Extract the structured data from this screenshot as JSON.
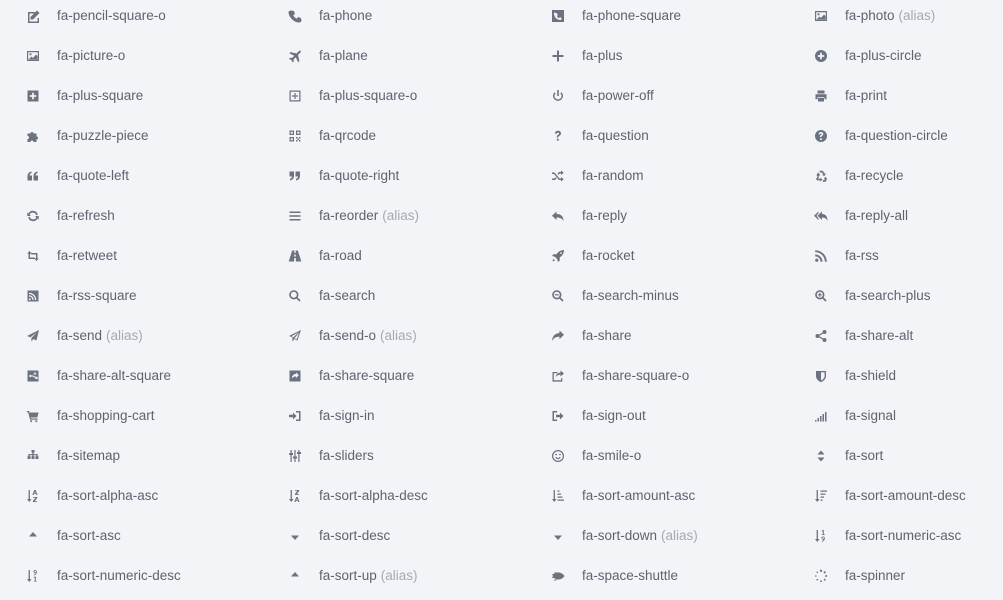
{
  "icons": [
    {
      "name": "fa-pencil-square-o",
      "icon": "pencil-square-o-icon",
      "alias": ""
    },
    {
      "name": "fa-phone",
      "icon": "phone-icon",
      "alias": ""
    },
    {
      "name": "fa-phone-square",
      "icon": "phone-square-icon",
      "alias": ""
    },
    {
      "name": "fa-photo",
      "icon": "photo-icon",
      "alias": "(alias)"
    },
    {
      "name": "fa-picture-o",
      "icon": "picture-o-icon",
      "alias": ""
    },
    {
      "name": "fa-plane",
      "icon": "plane-icon",
      "alias": ""
    },
    {
      "name": "fa-plus",
      "icon": "plus-icon",
      "alias": ""
    },
    {
      "name": "fa-plus-circle",
      "icon": "plus-circle-icon",
      "alias": ""
    },
    {
      "name": "fa-plus-square",
      "icon": "plus-square-icon",
      "alias": ""
    },
    {
      "name": "fa-plus-square-o",
      "icon": "plus-square-o-icon",
      "alias": ""
    },
    {
      "name": "fa-power-off",
      "icon": "power-off-icon",
      "alias": ""
    },
    {
      "name": "fa-print",
      "icon": "print-icon",
      "alias": ""
    },
    {
      "name": "fa-puzzle-piece",
      "icon": "puzzle-piece-icon",
      "alias": ""
    },
    {
      "name": "fa-qrcode",
      "icon": "qrcode-icon",
      "alias": ""
    },
    {
      "name": "fa-question",
      "icon": "question-icon",
      "alias": ""
    },
    {
      "name": "fa-question-circle",
      "icon": "question-circle-icon",
      "alias": ""
    },
    {
      "name": "fa-quote-left",
      "icon": "quote-left-icon",
      "alias": ""
    },
    {
      "name": "fa-quote-right",
      "icon": "quote-right-icon",
      "alias": ""
    },
    {
      "name": "fa-random",
      "icon": "random-icon",
      "alias": ""
    },
    {
      "name": "fa-recycle",
      "icon": "recycle-icon",
      "alias": ""
    },
    {
      "name": "fa-refresh",
      "icon": "refresh-icon",
      "alias": ""
    },
    {
      "name": "fa-reorder",
      "icon": "reorder-icon",
      "alias": "(alias)"
    },
    {
      "name": "fa-reply",
      "icon": "reply-icon",
      "alias": ""
    },
    {
      "name": "fa-reply-all",
      "icon": "reply-all-icon",
      "alias": ""
    },
    {
      "name": "fa-retweet",
      "icon": "retweet-icon",
      "alias": ""
    },
    {
      "name": "fa-road",
      "icon": "road-icon",
      "alias": ""
    },
    {
      "name": "fa-rocket",
      "icon": "rocket-icon",
      "alias": ""
    },
    {
      "name": "fa-rss",
      "icon": "rss-icon",
      "alias": ""
    },
    {
      "name": "fa-rss-square",
      "icon": "rss-square-icon",
      "alias": ""
    },
    {
      "name": "fa-search",
      "icon": "search-icon",
      "alias": ""
    },
    {
      "name": "fa-search-minus",
      "icon": "search-minus-icon",
      "alias": ""
    },
    {
      "name": "fa-search-plus",
      "icon": "search-plus-icon",
      "alias": ""
    },
    {
      "name": "fa-send",
      "icon": "send-icon",
      "alias": "(alias)"
    },
    {
      "name": "fa-send-o",
      "icon": "send-o-icon",
      "alias": "(alias)"
    },
    {
      "name": "fa-share",
      "icon": "share-icon",
      "alias": ""
    },
    {
      "name": "fa-share-alt",
      "icon": "share-alt-icon",
      "alias": ""
    },
    {
      "name": "fa-share-alt-square",
      "icon": "share-alt-square-icon",
      "alias": ""
    },
    {
      "name": "fa-share-square",
      "icon": "share-square-icon",
      "alias": ""
    },
    {
      "name": "fa-share-square-o",
      "icon": "share-square-o-icon",
      "alias": ""
    },
    {
      "name": "fa-shield",
      "icon": "shield-icon",
      "alias": ""
    },
    {
      "name": "fa-shopping-cart",
      "icon": "shopping-cart-icon",
      "alias": ""
    },
    {
      "name": "fa-sign-in",
      "icon": "sign-in-icon",
      "alias": ""
    },
    {
      "name": "fa-sign-out",
      "icon": "sign-out-icon",
      "alias": ""
    },
    {
      "name": "fa-signal",
      "icon": "signal-icon",
      "alias": ""
    },
    {
      "name": "fa-sitemap",
      "icon": "sitemap-icon",
      "alias": ""
    },
    {
      "name": "fa-sliders",
      "icon": "sliders-icon",
      "alias": ""
    },
    {
      "name": "fa-smile-o",
      "icon": "smile-o-icon",
      "alias": ""
    },
    {
      "name": "fa-sort",
      "icon": "sort-icon",
      "alias": ""
    },
    {
      "name": "fa-sort-alpha-asc",
      "icon": "sort-alpha-asc-icon",
      "alias": ""
    },
    {
      "name": "fa-sort-alpha-desc",
      "icon": "sort-alpha-desc-icon",
      "alias": ""
    },
    {
      "name": "fa-sort-amount-asc",
      "icon": "sort-amount-asc-icon",
      "alias": ""
    },
    {
      "name": "fa-sort-amount-desc",
      "icon": "sort-amount-desc-icon",
      "alias": ""
    },
    {
      "name": "fa-sort-asc",
      "icon": "sort-asc-icon",
      "alias": ""
    },
    {
      "name": "fa-sort-desc",
      "icon": "sort-desc-icon",
      "alias": ""
    },
    {
      "name": "fa-sort-down",
      "icon": "sort-down-icon",
      "alias": "(alias)"
    },
    {
      "name": "fa-sort-numeric-asc",
      "icon": "sort-numeric-asc-icon",
      "alias": ""
    },
    {
      "name": "fa-sort-numeric-desc",
      "icon": "sort-numeric-desc-icon",
      "alias": ""
    },
    {
      "name": "fa-sort-up",
      "icon": "sort-up-icon",
      "alias": "(alias)"
    },
    {
      "name": "fa-space-shuttle",
      "icon": "space-shuttle-icon",
      "alias": ""
    },
    {
      "name": "fa-spinner",
      "icon": "spinner-icon",
      "alias": ""
    }
  ],
  "colors": {
    "background": "#f3f4f7",
    "text": "#5c6470",
    "alias": "#a4a9b3",
    "icon": "#6b7280"
  }
}
